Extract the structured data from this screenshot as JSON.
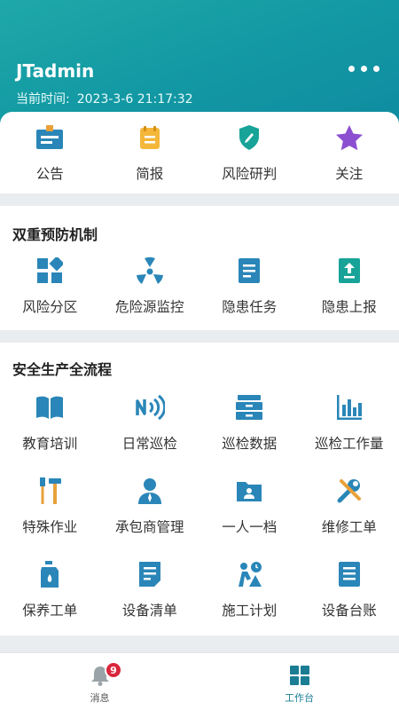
{
  "header": {
    "username": "JTadmin",
    "time_label": "当前时间:",
    "time_value": "2023-3-6 21:17:32"
  },
  "quick": [
    {
      "label": "公告",
      "icon": "announcement-icon"
    },
    {
      "label": "简报",
      "icon": "briefing-icon"
    },
    {
      "label": "风险研判",
      "icon": "shield-icon"
    },
    {
      "label": "关注",
      "icon": "star-icon"
    }
  ],
  "section1": {
    "title": "双重预防机制",
    "items": [
      {
        "label": "风险分区",
        "icon": "grid-blocks-icon"
      },
      {
        "label": "危险源监控",
        "icon": "radiation-icon"
      },
      {
        "label": "隐患任务",
        "icon": "document-icon"
      },
      {
        "label": "隐患上报",
        "icon": "upload-doc-icon"
      }
    ]
  },
  "section2": {
    "title": "安全生产全流程",
    "items": [
      {
        "label": "教育培训",
        "icon": "book-icon"
      },
      {
        "label": "日常巡检",
        "icon": "nfc-icon"
      },
      {
        "label": "巡检数据",
        "icon": "cabinet-icon"
      },
      {
        "label": "巡检工作量",
        "icon": "bar-chart-icon"
      },
      {
        "label": "特殊作业",
        "icon": "tools-icon"
      },
      {
        "label": "承包商管理",
        "icon": "person-icon"
      },
      {
        "label": "一人一档",
        "icon": "folder-person-icon"
      },
      {
        "label": "维修工单",
        "icon": "wrench-icon"
      },
      {
        "label": "保养工单",
        "icon": "oil-can-icon"
      },
      {
        "label": "设备清单",
        "icon": "list-doc-icon"
      },
      {
        "label": "施工计划",
        "icon": "construction-icon"
      },
      {
        "label": "设备台账",
        "icon": "ledger-icon"
      }
    ]
  },
  "tabbar": {
    "messages_label": "消息",
    "messages_badge": "9",
    "workbench_label": "工作台"
  },
  "colors": {
    "accent": "#1a7d94",
    "teal": "#139aa4",
    "badge": "#d9253a"
  }
}
